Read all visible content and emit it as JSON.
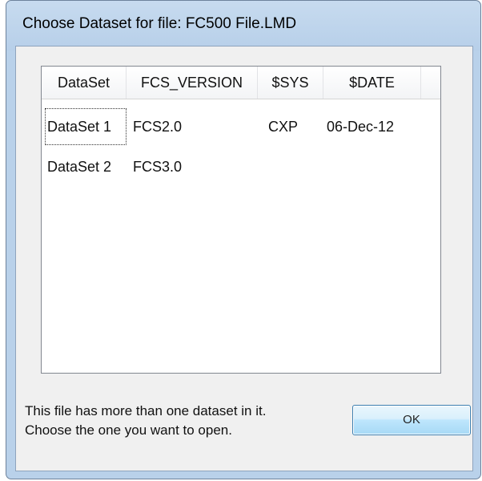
{
  "dialog": {
    "title": "Choose Dataset for file:  FC500 File.LMD",
    "message_line1": "This file has more than one dataset in it.",
    "message_line2": "Choose the one you want to open.",
    "ok_label": "OK"
  },
  "list": {
    "columns": [
      "DataSet",
      "FCS_VERSION",
      "$SYS",
      "$DATE"
    ],
    "rows": [
      [
        "DataSet 1",
        "FCS2.0",
        "CXP",
        "06-Dec-12"
      ],
      [
        "DataSet 2",
        "FCS3.0",
        "",
        ""
      ]
    ],
    "selected_row": "DataSet 1"
  }
}
